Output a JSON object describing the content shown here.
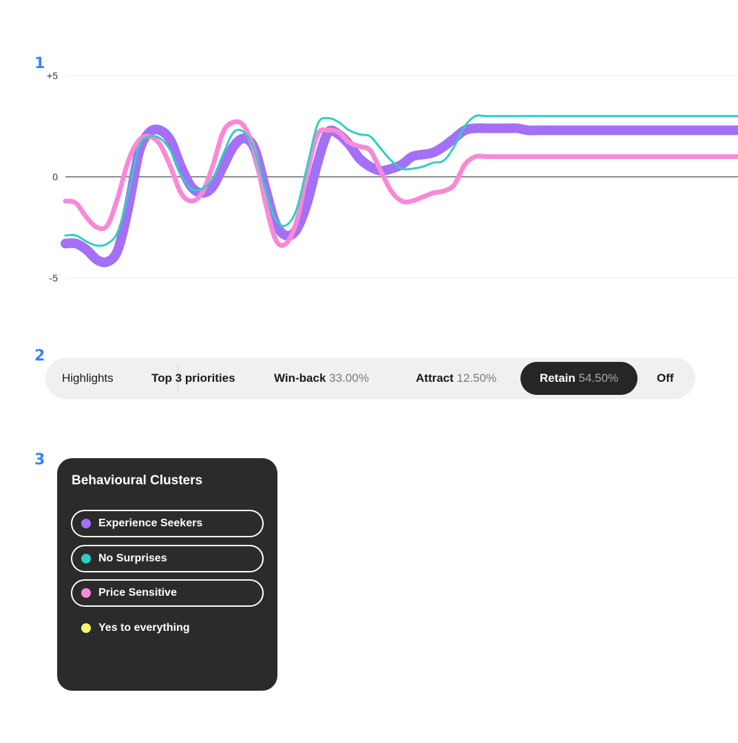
{
  "sections": [
    "1",
    "2",
    "3"
  ],
  "chart_data": {
    "type": "line",
    "yticks": [
      "+5",
      "0",
      "-5"
    ],
    "ylim": [
      -5,
      5
    ],
    "x": [
      0,
      1,
      2,
      3,
      4,
      5,
      6,
      7,
      8,
      9,
      10,
      11,
      12,
      13,
      14,
      15,
      16,
      17,
      18,
      19,
      20,
      21,
      22,
      23,
      24,
      25,
      26,
      27,
      28,
      29,
      30,
      31,
      32,
      33,
      34,
      35,
      36,
      37,
      38,
      39,
      40,
      41,
      42,
      43,
      44,
      45,
      46,
      47,
      48,
      49,
      50,
      51,
      52,
      53,
      54,
      55,
      56,
      57,
      58,
      59,
      60,
      61,
      62,
      63,
      64
    ],
    "grid": true,
    "series": [
      {
        "name": "Experience Seekers",
        "color": "#a370f7",
        "width": 14,
        "values": [
          -3.3,
          -3.3,
          -3.6,
          -4.1,
          -4.2,
          -3.6,
          -1.5,
          1.2,
          2.2,
          2.3,
          1.8,
          0.5,
          -0.5,
          -0.8,
          -0.5,
          0.5,
          1.5,
          1.9,
          1.4,
          -0.5,
          -2.3,
          -2.9,
          -2.6,
          -1.3,
          0.7,
          2.2,
          2.1,
          1.6,
          0.9,
          0.5,
          0.3,
          0.4,
          0.6,
          1.0,
          1.1,
          1.2,
          1.5,
          1.9,
          2.3,
          2.4,
          2.4,
          2.4,
          2.4,
          2.4,
          2.3,
          2.3,
          2.3,
          2.3,
          2.3,
          2.3,
          2.3,
          2.3,
          2.3,
          2.3,
          2.3,
          2.3,
          2.3,
          2.3,
          2.3,
          2.3,
          2.3,
          2.3,
          2.3,
          2.3,
          2.3
        ]
      },
      {
        "name": "No Surprises",
        "color": "#2dcfc0",
        "width": 3,
        "values": [
          -2.9,
          -2.9,
          -3.2,
          -3.4,
          -3.3,
          -2.7,
          -0.8,
          1.5,
          2.0,
          1.9,
          1.3,
          0.1,
          -0.6,
          -0.6,
          -0.1,
          1.1,
          2.2,
          2.2,
          1.3,
          -0.6,
          -2.1,
          -2.4,
          -1.6,
          0.5,
          2.6,
          2.9,
          2.7,
          2.3,
          2.1,
          2.0,
          1.4,
          0.8,
          0.4,
          0.4,
          0.5,
          0.7,
          0.8,
          1.5,
          2.5,
          3.0,
          3.0,
          3.0,
          3.0,
          3.0,
          3.0,
          3.0,
          3.0,
          3.0,
          3.0,
          3.0,
          3.0,
          3.0,
          3.0,
          3.0,
          3.0,
          3.0,
          3.0,
          3.0,
          3.0,
          3.0,
          3.0,
          3.0,
          3.0,
          3.0,
          3.0
        ]
      },
      {
        "name": "Price Sensitive",
        "color": "#f989d6",
        "width": 7,
        "values": [
          -1.2,
          -1.3,
          -2.0,
          -2.5,
          -2.4,
          -1.0,
          0.8,
          1.8,
          2.0,
          1.6,
          0.5,
          -0.8,
          -1.2,
          -0.8,
          0.5,
          2.2,
          2.7,
          2.5,
          1.2,
          -1.2,
          -3.1,
          -3.3,
          -2.2,
          0.2,
          2.1,
          2.3,
          2.2,
          1.7,
          1.5,
          1.3,
          0.3,
          -0.7,
          -1.2,
          -1.2,
          -1.0,
          -0.8,
          -0.7,
          -0.4,
          0.6,
          1.0,
          1.0,
          1.0,
          1.0,
          1.0,
          1.0,
          1.0,
          1.0,
          1.0,
          1.0,
          1.0,
          1.0,
          1.0,
          1.0,
          1.0,
          1.0,
          1.0,
          1.0,
          1.0,
          1.0,
          1.0,
          1.0,
          1.0,
          1.0,
          1.0,
          1.0
        ]
      }
    ]
  },
  "toolbar": {
    "highlights": "Highlights",
    "top3": "Top 3 priorities",
    "winback_label": "Win-back",
    "winback_pct": "33.00%",
    "attract_label": "Attract",
    "attract_pct": "12.50%",
    "retain_label": "Retain",
    "retain_pct": "54.50%",
    "off": "Off",
    "active": "Retain"
  },
  "legend": {
    "title": "Behavioural Clusters",
    "items": [
      {
        "label": "Experience Seekers",
        "color": "#a370f7",
        "selected": true
      },
      {
        "label": "No Surprises",
        "color": "#2dcfc0",
        "selected": true
      },
      {
        "label": "Price Sensitive",
        "color": "#f989d6",
        "selected": true
      },
      {
        "label": "Yes to everything",
        "color": "#f9f871",
        "selected": false
      }
    ]
  }
}
